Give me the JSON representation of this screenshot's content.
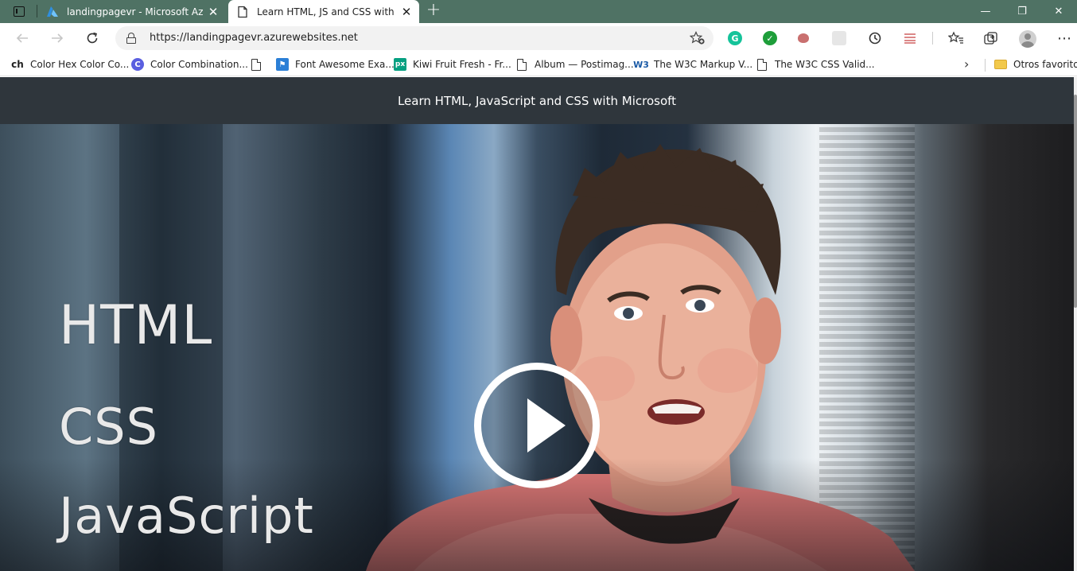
{
  "browser": {
    "tabs": [
      {
        "title": "landingpagevr - Microsoft Azure",
        "active": false,
        "icon": "azure-icon"
      },
      {
        "title": "Learn HTML, JS and CSS with Mic",
        "active": true,
        "icon": "page-icon"
      }
    ],
    "new_tab_label": "+",
    "window_controls": {
      "minimize": "—",
      "restore": "❐",
      "close": "✕"
    },
    "address_bar": {
      "url": "https://landingpagevr.azurewebsites.net"
    },
    "bookmarks": [
      {
        "label": "Color Hex Color Co...",
        "icon": "ch"
      },
      {
        "label": "Color Combination...",
        "icon": "C"
      },
      {
        "label": "Font Awesome Exa...",
        "icon": "page-icon"
      },
      {
        "label": "Kiwi Fruit Fresh - Fr...",
        "icon": "px"
      },
      {
        "label": "Album — Postimag...",
        "icon": "page-icon"
      },
      {
        "label": "The W3C Markup V...",
        "icon": "W3"
      },
      {
        "label": "The W3C CSS Valid...",
        "icon": "page-icon"
      }
    ],
    "other_favorites_label": "Otros favoritos"
  },
  "page": {
    "header_title": "Learn HTML, JavaScript and CSS with Microsoft",
    "video": {
      "overlay_lines": [
        "HTML",
        "CSS",
        "JavaScript"
      ]
    }
  },
  "colors": {
    "tabstrip": "#4f7264",
    "page_header": "#2f363c",
    "grammarly": "#15c39a",
    "check_ext": "#1e9e3a"
  }
}
